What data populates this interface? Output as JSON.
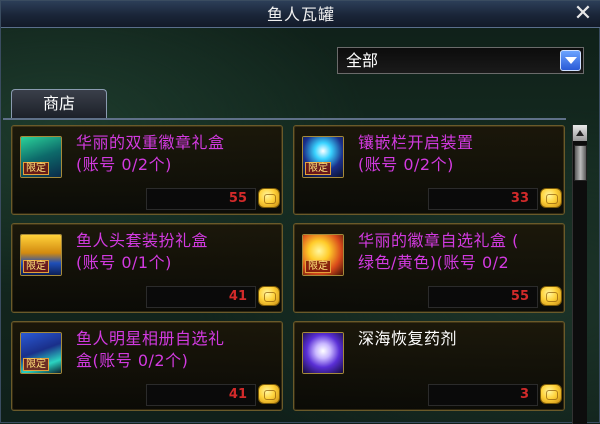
{
  "window": {
    "title": "鱼人瓦罐",
    "close_label": "✕"
  },
  "filter": {
    "selected": "全部"
  },
  "tabs": [
    {
      "label": "商店"
    }
  ],
  "items": [
    {
      "name_line1": "华丽的双重徽章礼盒",
      "name_line2": "(账号 0/2个)",
      "price": "55",
      "badge": "限定",
      "name_color": "#d23ae0"
    },
    {
      "name_line1": "镶嵌栏开启装置",
      "name_line2": "(账号 0/2个)",
      "price": "33",
      "badge": "限定",
      "name_color": "#d23ae0"
    },
    {
      "name_line1": "鱼人头套装扮礼盒",
      "name_line2": "(账号 0/1个)",
      "price": "41",
      "badge": "限定",
      "name_color": "#d23ae0"
    },
    {
      "name_line1": "华丽的徽章自选礼盒 (",
      "name_line2": "绿色/黄色)(账号 0/2",
      "price": "55",
      "badge": "限定",
      "name_color": "#d23ae0"
    },
    {
      "name_line1": "鱼人明星相册自选礼",
      "name_line2": "盒(账号 0/2个)",
      "price": "41",
      "badge": "限定",
      "name_color": "#d23ae0"
    },
    {
      "name_line1": "深海恢复药剂",
      "name_line2": "",
      "price": "3",
      "badge": "",
      "name_color": "#ffffff"
    }
  ],
  "colors": {
    "title_bar": "#1a2538",
    "accent_purple": "#d23ae0",
    "price_red": "#d22a2a",
    "coin_gold": "#ffd23a"
  }
}
